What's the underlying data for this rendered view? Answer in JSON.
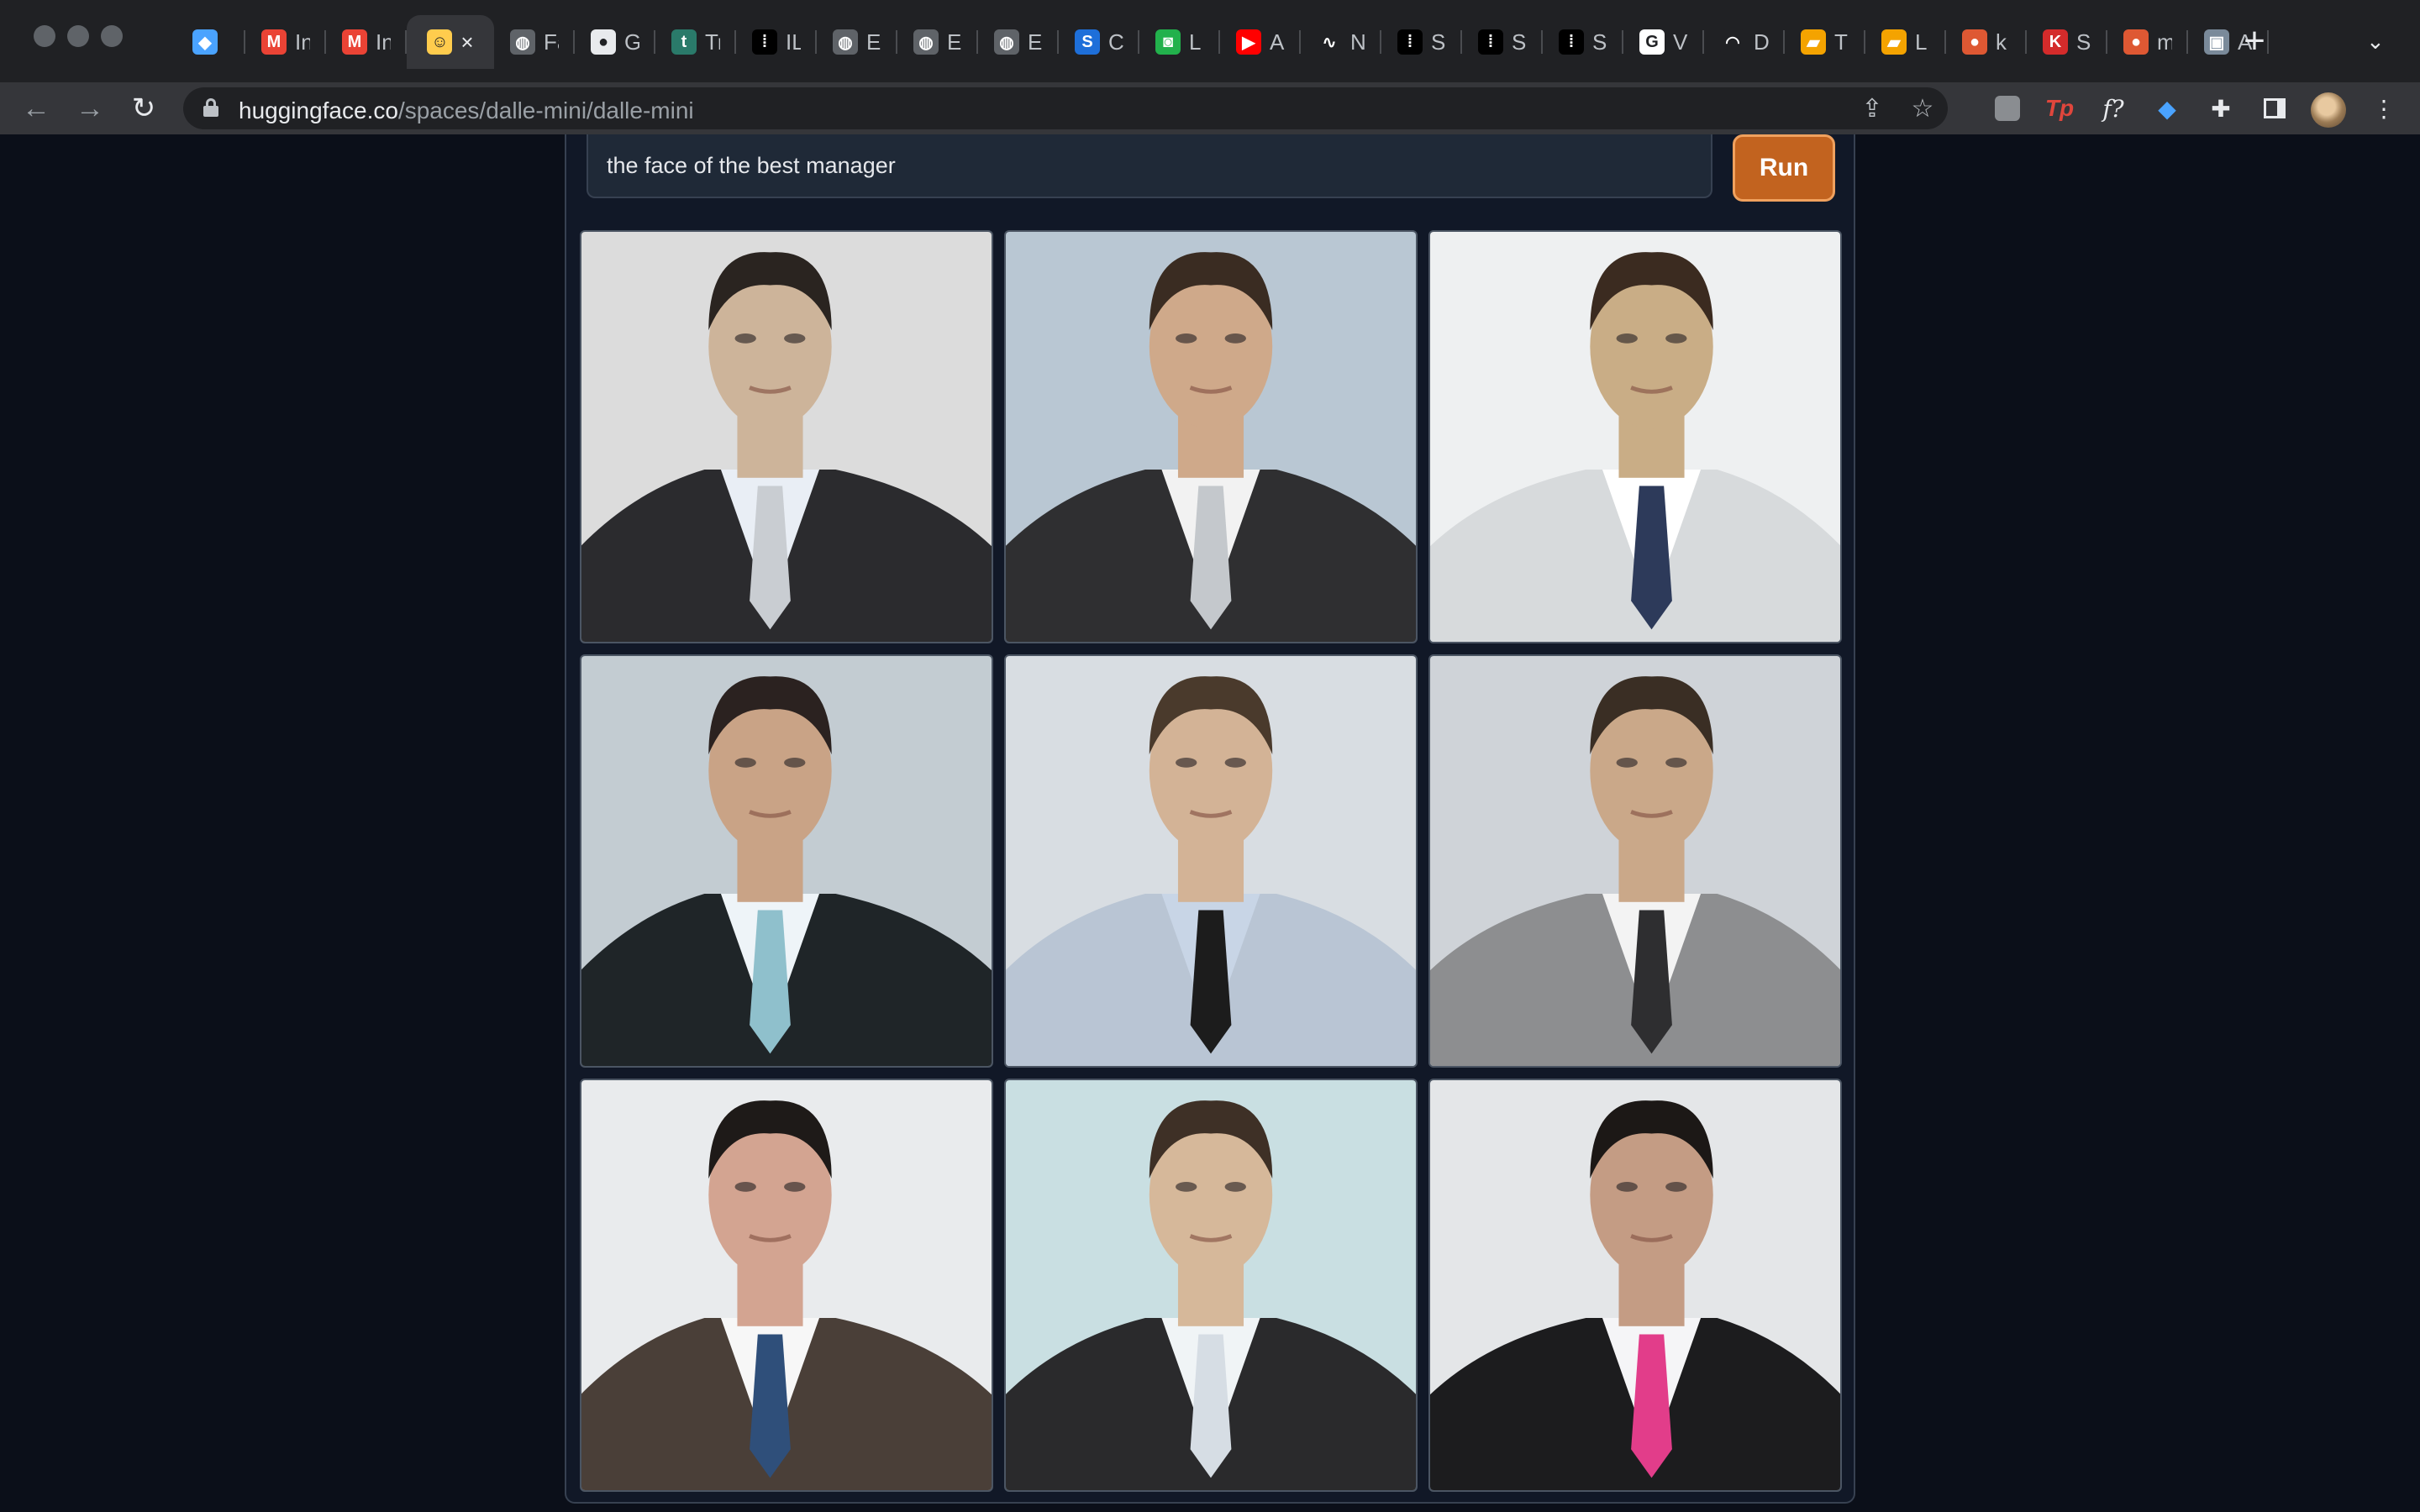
{
  "browser": {
    "tabs": [
      {
        "favicon": "gem-icon",
        "label": "",
        "color": "#4aa3ff",
        "glyph": "◆"
      },
      {
        "favicon": "gmail-icon",
        "label": "In",
        "color": "#ea4335",
        "glyph": "M"
      },
      {
        "favicon": "gmail-icon",
        "label": "In",
        "color": "#ea4335",
        "glyph": "M"
      },
      {
        "favicon": "huggingface-icon",
        "label": "",
        "color": "#ffcc4d",
        "glyph": "☺",
        "active": true
      },
      {
        "favicon": "globe-icon",
        "label": "Fa",
        "color": "#5f6368",
        "glyph": "◍"
      },
      {
        "favicon": "github-icon",
        "label": "G",
        "color": "#e8eaed",
        "glyph": "●"
      },
      {
        "favicon": "t-icon",
        "label": "Tr",
        "color": "#2a7a6a",
        "glyph": "t"
      },
      {
        "favicon": "dotted-icon",
        "label": "IL",
        "color": "#000000",
        "glyph": "⁞"
      },
      {
        "favicon": "globe-icon",
        "label": "E",
        "color": "#5f6368",
        "glyph": "◍"
      },
      {
        "favicon": "globe-icon",
        "label": "E",
        "color": "#5f6368",
        "glyph": "◍"
      },
      {
        "favicon": "globe-icon",
        "label": "E",
        "color": "#5f6368",
        "glyph": "◍"
      },
      {
        "favicon": "s-icon",
        "label": "C",
        "color": "#1e6fd9",
        "glyph": "S"
      },
      {
        "favicon": "robot-icon",
        "label": "L",
        "color": "#22b14c",
        "glyph": "◙"
      },
      {
        "favicon": "youtube-icon",
        "label": "A",
        "color": "#ff0000",
        "glyph": "▶"
      },
      {
        "favicon": "waveform-icon",
        "label": "N",
        "color": "#202124",
        "glyph": "∿"
      },
      {
        "favicon": "dotted-icon",
        "label": "S",
        "color": "#000000",
        "glyph": "⁞"
      },
      {
        "favicon": "dotted-icon",
        "label": "S",
        "color": "#000000",
        "glyph": "⁞"
      },
      {
        "favicon": "dotted-icon",
        "label": "S",
        "color": "#000000",
        "glyph": "⁞"
      },
      {
        "favicon": "google-icon",
        "label": "V",
        "color": "#ffffff",
        "glyph": "G"
      },
      {
        "favicon": "arc-icon",
        "label": "D",
        "color": "#202124",
        "glyph": "◠"
      },
      {
        "favicon": "book-icon",
        "label": "T",
        "color": "#f4a300",
        "glyph": "▰"
      },
      {
        "favicon": "book-icon",
        "label": "L",
        "color": "#f4a300",
        "glyph": "▰"
      },
      {
        "favicon": "duckduckgo-icon",
        "label": "k",
        "color": "#de5833",
        "glyph": "●"
      },
      {
        "favicon": "k-icon",
        "label": "S",
        "color": "#d42b2b",
        "glyph": "K"
      },
      {
        "favicon": "duckduckgo-icon",
        "label": "m",
        "color": "#de5833",
        "glyph": "●"
      },
      {
        "favicon": "image-icon",
        "label": "A",
        "color": "#7a8a9a",
        "glyph": "▣"
      }
    ],
    "url_host": "huggingface.co",
    "url_path": "/spaces/dalle-mini/dalle-mini"
  },
  "app": {
    "prompt_text": "the face of the best manager",
    "run_label": "Run",
    "accent": "#c2631f",
    "images": [
      {
        "bg": "#dcdcdc",
        "suit": "#2b2b2e",
        "tie": "#c9cdd2",
        "shirt": "#e9eef5",
        "skin": "#cdb49a",
        "hair": "#2a2420"
      },
      {
        "bg": "#b9c7d3",
        "suit": "#2f2f31",
        "tie": "#c4c8cc",
        "shirt": "#f2f2f2",
        "skin": "#cfa98a",
        "hair": "#3a2c22"
      },
      {
        "bg": "#eef0f1",
        "suit": "#d7dadc",
        "tie": "#2d3a5a",
        "shirt": "#ffffff",
        "skin": "#c9ad86",
        "hair": "#3b2b20"
      },
      {
        "bg": "#c3ccd2",
        "suit": "#1f2528",
        "tie": "#8fc0cc",
        "shirt": "#eef4f8",
        "skin": "#c9a386",
        "hair": "#2b2220"
      },
      {
        "bg": "#d8dde2",
        "suit": "#b9c5d4",
        "tie": "#1c1c1c",
        "shirt": "#c8d5e6",
        "skin": "#d3b396",
        "hair": "#4a3a2c"
      },
      {
        "bg": "#cfd3d8",
        "suit": "#8d8e90",
        "tie": "#2e2e30",
        "shirt": "#f3f3f3",
        "skin": "#caa889",
        "hair": "#3a2e24"
      },
      {
        "bg": "#e9ebed",
        "suit": "#4a3f38",
        "tie": "#2f4f7a",
        "shirt": "#f7f7f7",
        "skin": "#d3a491",
        "hair": "#1e1a18"
      },
      {
        "bg": "#c9dfe2",
        "suit": "#2a2a2c",
        "tie": "#d6dde4",
        "shirt": "#f0f4f6",
        "skin": "#d6b89a",
        "hair": "#3e3026"
      },
      {
        "bg": "#e4e6e8",
        "suit": "#1c1c1e",
        "tie": "#e23d8a",
        "shirt": "#f5f5f7",
        "skin": "#c49c84",
        "hair": "#1c1816"
      }
    ]
  }
}
